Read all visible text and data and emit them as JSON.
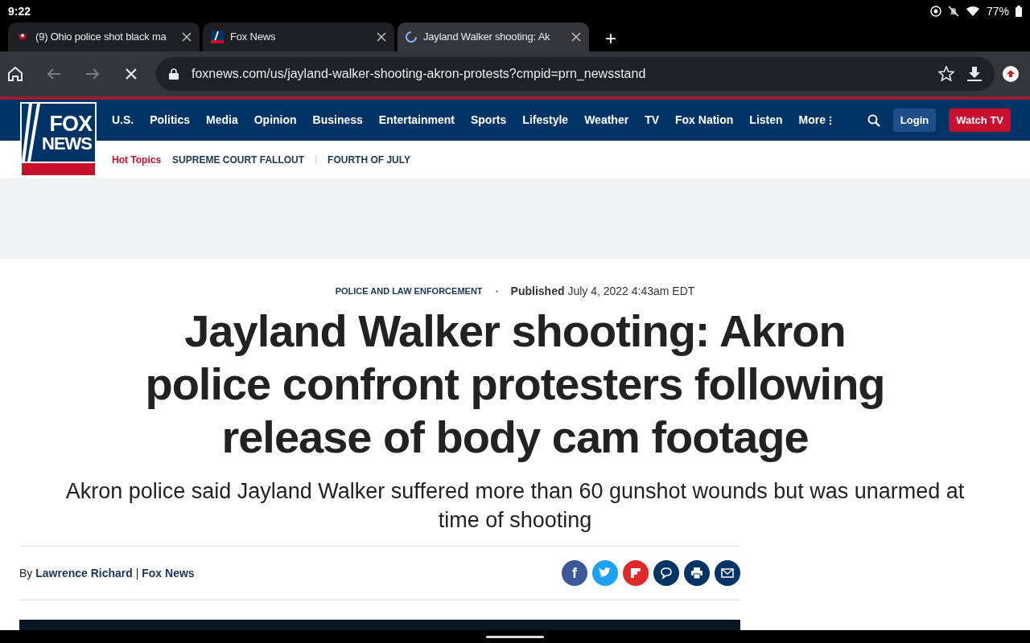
{
  "status_bar": {
    "time": "9:22",
    "battery": "77%"
  },
  "tabs": [
    {
      "title": "(9) Ohio police shot black ma",
      "kind": "emblem",
      "selected": false
    },
    {
      "title": "Fox News",
      "kind": "fox",
      "selected": false
    },
    {
      "title": "Jayland Walker shooting: Ak",
      "kind": "loading",
      "selected": true
    }
  ],
  "new_tab": "+",
  "address_bar": {
    "url": "foxnews.com/us/jayland-walker-shooting-akron-protests?cmpid=prn_newsstand"
  },
  "site_header": {
    "logo": [
      "FOX",
      "NEWS"
    ],
    "nav": [
      "U.S.",
      "Politics",
      "Media",
      "Opinion",
      "Business",
      "Entertainment",
      "Sports",
      "Lifestyle",
      "Weather",
      "TV",
      "Fox Nation",
      "Listen",
      "More"
    ],
    "login": "Login",
    "watch": "Watch TV"
  },
  "hot_topics": {
    "label": "Hot Topics",
    "items": [
      "SUPREME COURT FALLOUT",
      "FOURTH OF JULY"
    ]
  },
  "article": {
    "category": "POLICE AND LAW ENFORCEMENT",
    "published_label": "Published",
    "published_date": "July 4, 2022 4:43am EDT",
    "headline": "Jayland Walker shooting: Akron police confront protesters following release of body cam footage",
    "subheadline": "Akron police said Jayland Walker suffered more than 60 gunshot wounds but was unarmed at time of shooting",
    "byline_prefix": "By",
    "author": "Lawrence Richard",
    "separator": "|",
    "source": "Fox News",
    "share": [
      {
        "kind": "facebook",
        "color": "#3b5998",
        "glyph": "f"
      },
      {
        "kind": "twitter",
        "color": "#1da1f2"
      },
      {
        "kind": "flipboard",
        "color": "#e12828"
      },
      {
        "kind": "comment",
        "color": "#003366"
      },
      {
        "kind": "print",
        "color": "#003366"
      },
      {
        "kind": "email",
        "color": "#003366"
      }
    ]
  }
}
